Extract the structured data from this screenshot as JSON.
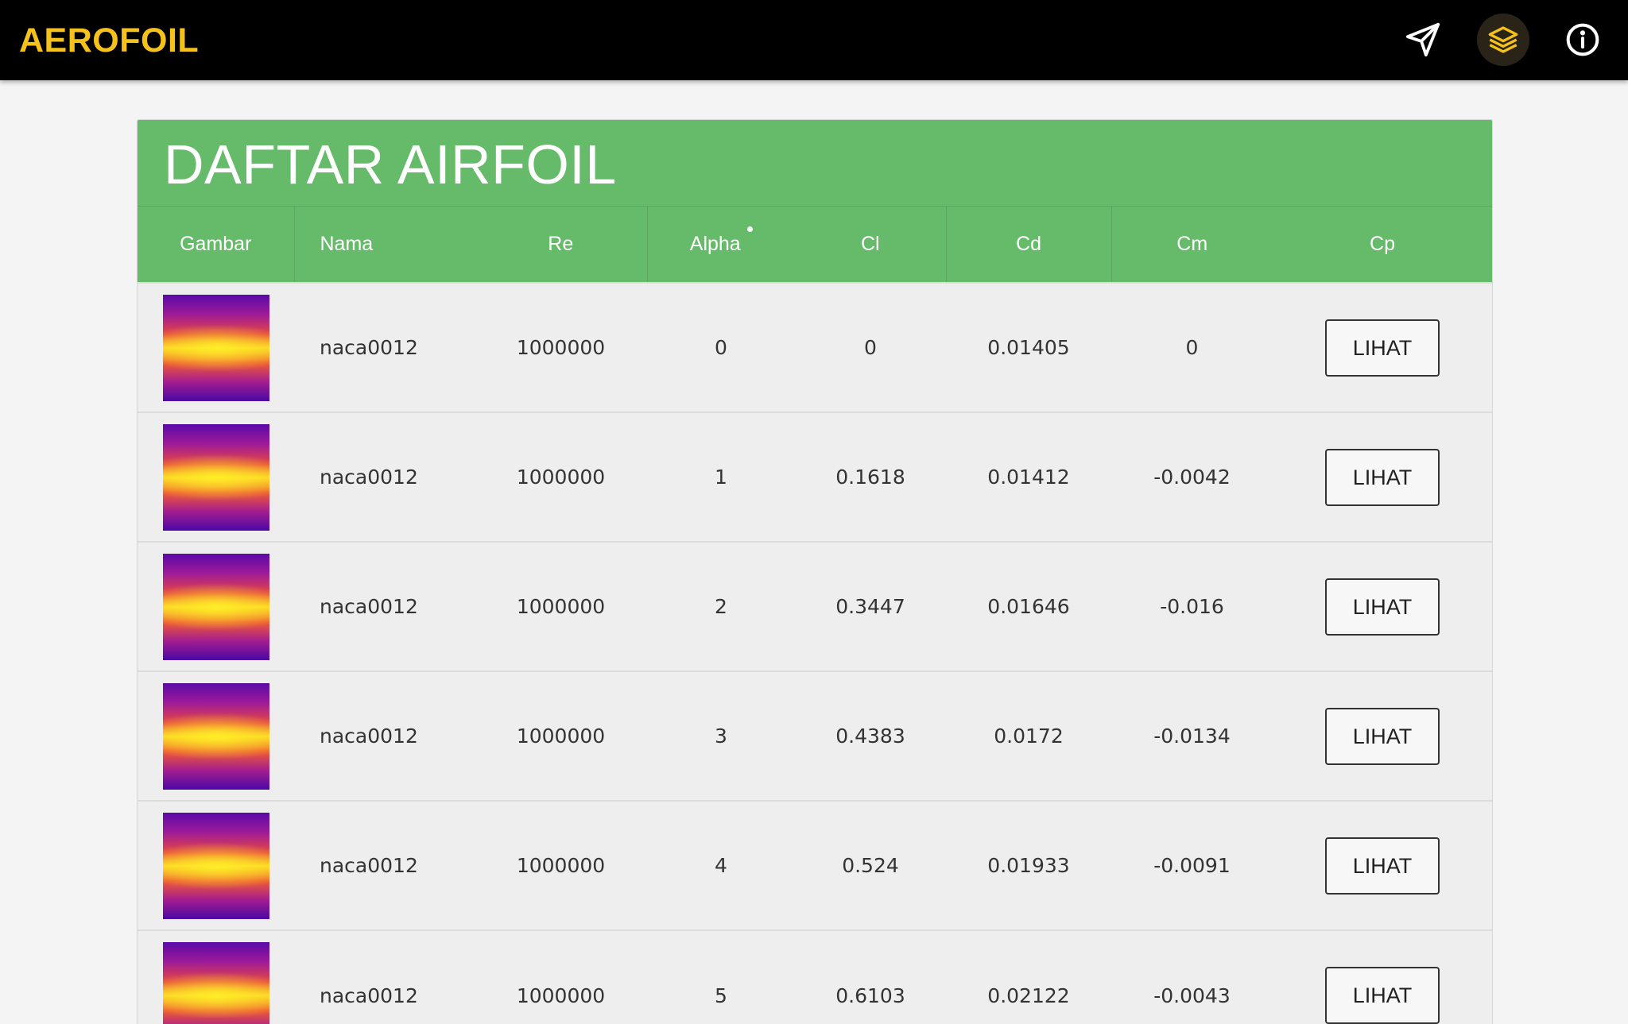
{
  "navbar": {
    "brand": "AEROFOIL",
    "icons": [
      "send-icon",
      "layers-icon",
      "info-icon"
    ],
    "brand_color": "#f5c11b",
    "background": "#000000"
  },
  "card": {
    "title": "DAFTAR AIRFOIL",
    "header_color": "#66bb6a",
    "columns": [
      "Gambar",
      "Nama",
      "Re",
      "Alpha",
      "Cl",
      "Cd",
      "Cm",
      "Cp"
    ],
    "sorted_column": "Alpha",
    "rows": [
      {
        "nama": "naca0012",
        "re": "1000000",
        "alpha": "0",
        "cl": "0",
        "cd": "0.01405",
        "cm": "0",
        "cp": "LIHAT"
      },
      {
        "nama": "naca0012",
        "re": "1000000",
        "alpha": "1",
        "cl": "0.1618",
        "cd": "0.01412",
        "cm": "-0.0042",
        "cp": "LIHAT"
      },
      {
        "nama": "naca0012",
        "re": "1000000",
        "alpha": "2",
        "cl": "0.3447",
        "cd": "0.01646",
        "cm": "-0.016",
        "cp": "LIHAT"
      },
      {
        "nama": "naca0012",
        "re": "1000000",
        "alpha": "3",
        "cl": "0.4383",
        "cd": "0.0172",
        "cm": "-0.0134",
        "cp": "LIHAT"
      },
      {
        "nama": "naca0012",
        "re": "1000000",
        "alpha": "4",
        "cl": "0.524",
        "cd": "0.01933",
        "cm": "-0.0091",
        "cp": "LIHAT"
      },
      {
        "nama": "naca0012",
        "re": "1000000",
        "alpha": "5",
        "cl": "0.6103",
        "cd": "0.02122",
        "cm": "-0.0043",
        "cp": "LIHAT"
      }
    ]
  }
}
